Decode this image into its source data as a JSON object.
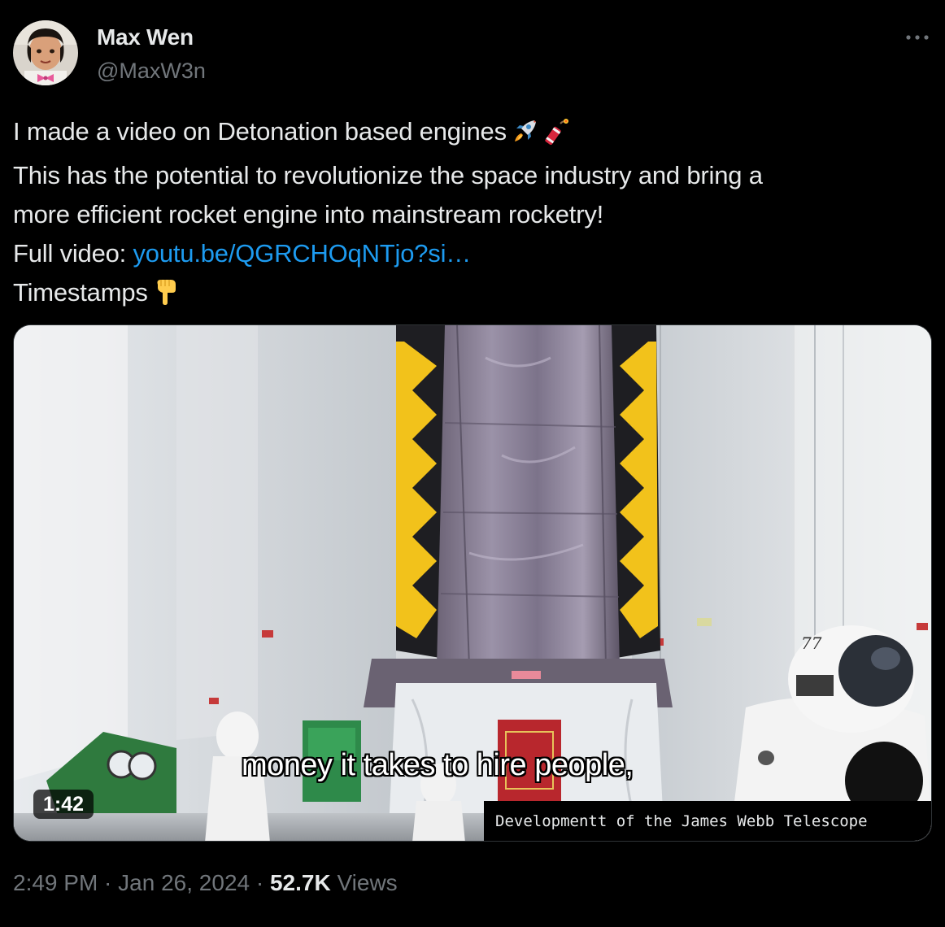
{
  "author": {
    "name": "Max Wen",
    "handle": "@MaxW3n"
  },
  "tweet": {
    "line1": "I made a video on Detonation based engines",
    "line2": "This has the potential to revolutionize the space industry and bring a",
    "line3": "more efficient rocket engine into mainstream rocketry!",
    "line4_prefix": "Full video: ",
    "link_text": "youtu.be/QGRCHOqNTjo?si…",
    "line5": "Timestamps",
    "emojis": [
      "rocket-emoji",
      "firecracker-emoji",
      "pointing-down-emoji"
    ]
  },
  "media": {
    "subtitle": "money it takes to hire people,",
    "caption": "Developmentt of the James Webb Telescope",
    "duration": "1:42",
    "helmet_number": "77"
  },
  "meta": {
    "time": "2:49 PM",
    "separator1": " · ",
    "date": "Jan 26, 2024",
    "separator2": " · ",
    "views_count": "52.7K",
    "views_label": " Views"
  },
  "colors": {
    "background": "#000000",
    "text_primary": "#e7e9ea",
    "text_secondary": "#71767b",
    "link": "#1d9bf0"
  }
}
